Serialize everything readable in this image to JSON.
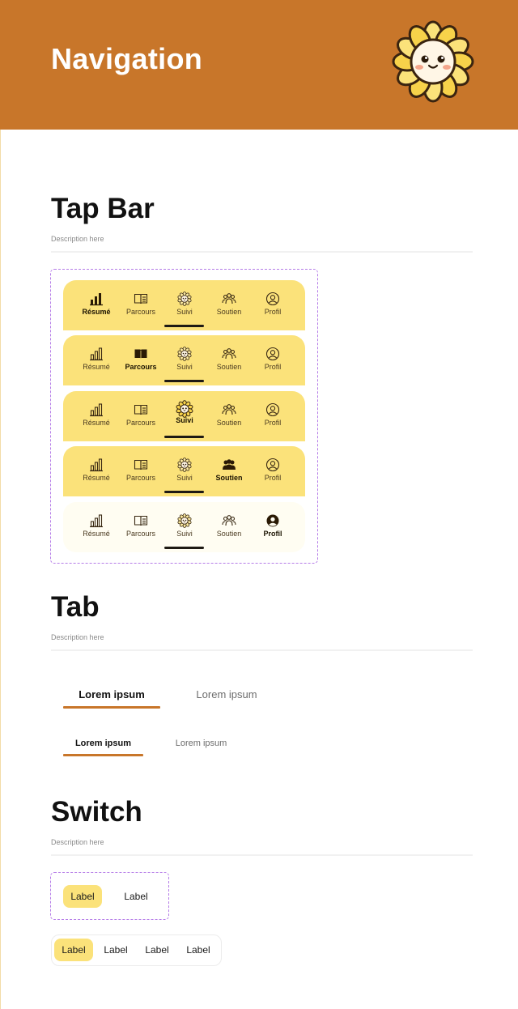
{
  "header": {
    "title": "Navigation"
  },
  "sections": {
    "tapbar": {
      "title": "Tap Bar",
      "description": "Description here"
    },
    "tab": {
      "title": "Tab",
      "description": "Description here"
    },
    "switch": {
      "title": "Switch",
      "description": "Description here"
    }
  },
  "tapbar_items": {
    "resume": "Résumé",
    "parcours": "Parcours",
    "suivi": "Suivi",
    "soutien": "Soutien",
    "profil": "Profil"
  },
  "tapbar_variants": [
    {
      "active": "resume",
      "theme": "yellow"
    },
    {
      "active": "parcours",
      "theme": "yellow"
    },
    {
      "active": "suivi",
      "theme": "yellow"
    },
    {
      "active": "soutien",
      "theme": "yellow"
    },
    {
      "active": "profil",
      "theme": "light"
    }
  ],
  "tabs": {
    "large": {
      "active_label": "Lorem ipsum",
      "inactive_label": "Lorem ipsum"
    },
    "small": {
      "active_label": "Lorem ipsum",
      "inactive_label": "Lorem ipsum"
    }
  },
  "switch": {
    "two_options": [
      "Label",
      "Label"
    ],
    "four_options": [
      "Label",
      "Label",
      "Label",
      "Label"
    ],
    "selected_index": 0
  },
  "colors": {
    "header_bg": "#c8762a",
    "accent_yellow": "#fbe27a",
    "accent_orange": "#c8762a",
    "frame_dash": "#b57ce8"
  },
  "icons": {
    "resume": "bar-chart-icon",
    "parcours": "open-book-icon",
    "suivi": "sunflower-icon",
    "soutien": "people-group-icon",
    "profil": "user-circle-icon"
  }
}
